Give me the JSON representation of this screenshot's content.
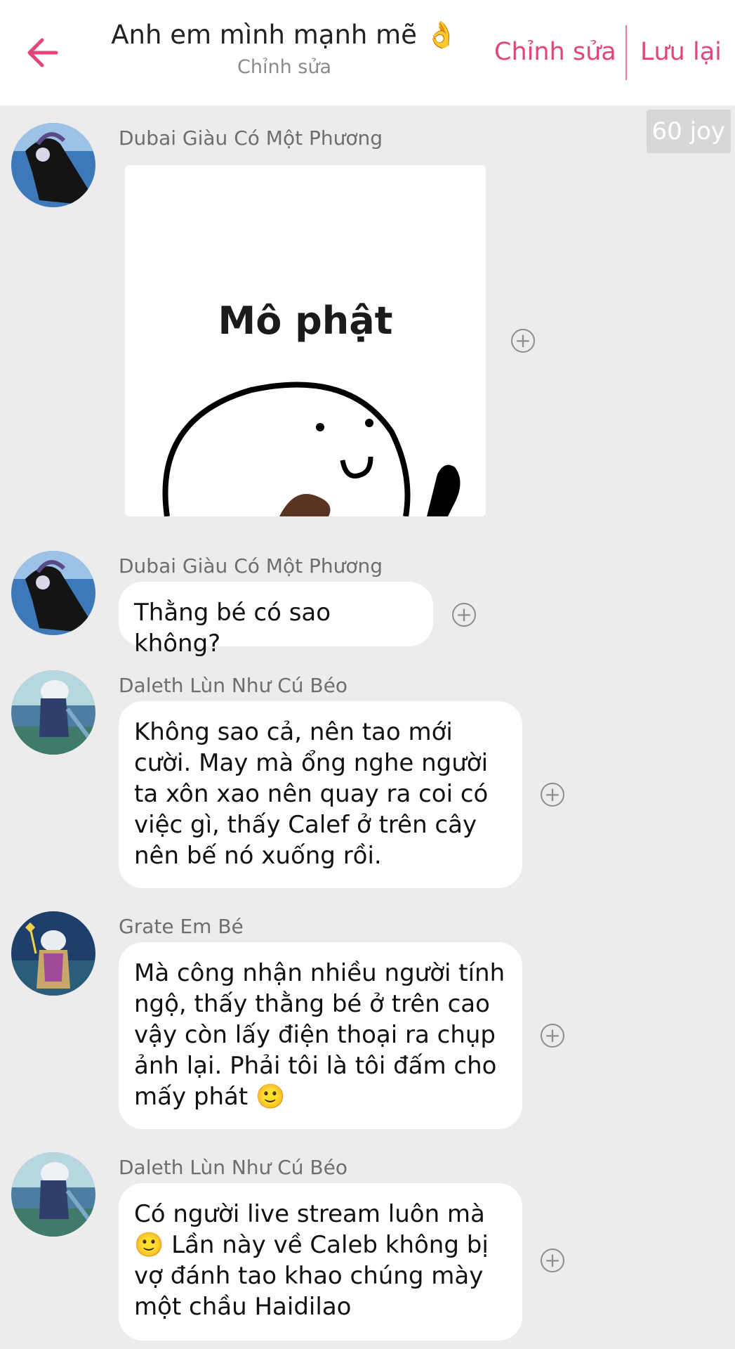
{
  "header": {
    "title": "Anh em mình mạnh mẽ 👌",
    "subtitle": "Chỉnh sửa",
    "edit_label": "Chỉnh sửa",
    "save_label": "Lưu lại",
    "accent_color": "#e0457b"
  },
  "joy_badge": "60 joy",
  "messages": [
    {
      "sender": "Dubai Giàu Có Một Phương",
      "type": "sticker",
      "sticker_text": "Mô phật"
    },
    {
      "sender": "Dubai Giàu Có Một Phương",
      "type": "text",
      "text": "Thằng bé có sao không?"
    },
    {
      "sender": "Daleth Lùn Như Cú Béo",
      "type": "text",
      "text": "Không sao cả, nên tao mới cười. May mà ổng nghe người ta xôn xao nên quay ra coi có việc gì, thấy Calef ở trên cây nên bế nó xuống rồi."
    },
    {
      "sender": "Grate Em Bé",
      "type": "text",
      "text": "Mà công nhận nhiều người tính ngộ, thấy thằng bé ở trên cao vậy còn lấy điện thoại ra chụp ảnh lại. Phải tôi là tôi đấm cho mấy phát 🙂"
    },
    {
      "sender": "Daleth Lùn Như Cú Béo",
      "type": "text",
      "text": "Có người live stream luôn mà 🙂 Lần này về Caleb không bị vợ đánh tao khao chúng mày một chầu Haidilao"
    }
  ],
  "icons": {
    "back": "arrow-left-icon",
    "add_reaction": "plus-circle-icon"
  }
}
